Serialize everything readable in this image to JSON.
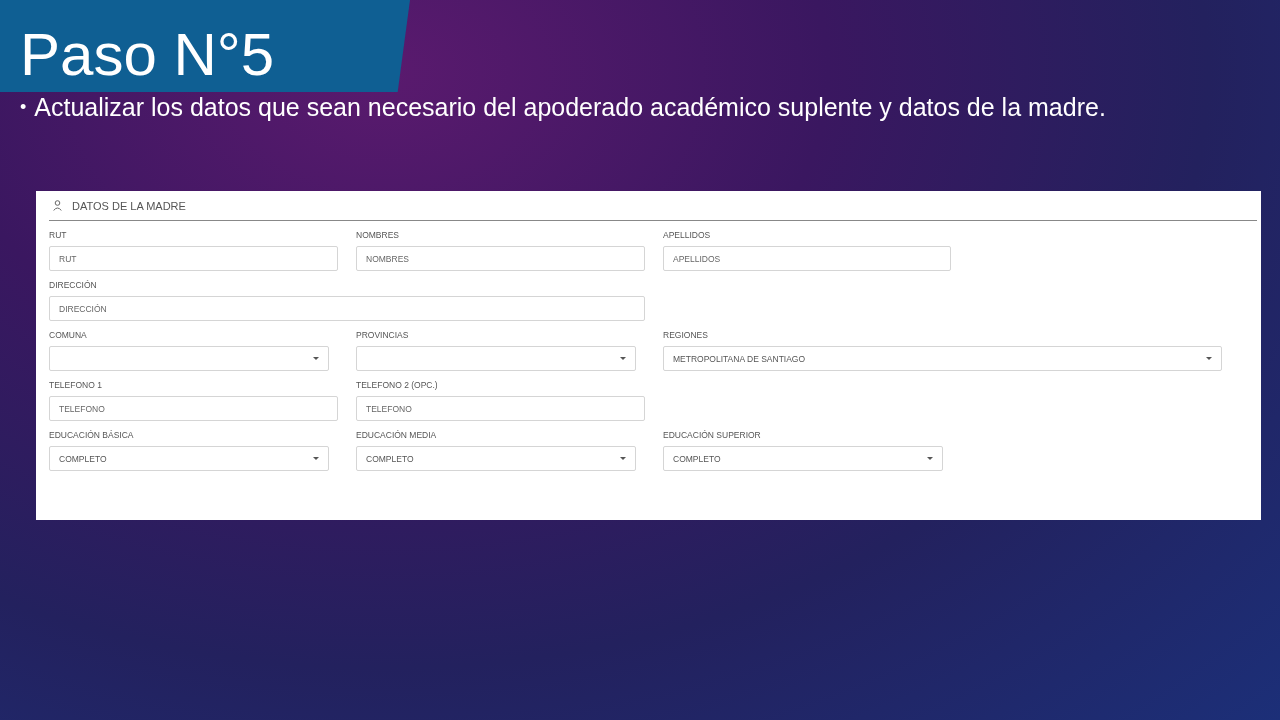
{
  "slide": {
    "title": "Paso N°5",
    "bullet_marker": "•",
    "bullet": "Actualizar los datos que sean necesario del apoderado académico suplente y datos de la madre."
  },
  "form": {
    "title": "DATOS DE LA MADRE",
    "rows": [
      {
        "fields": [
          {
            "label": "RUT",
            "kind": "text",
            "placeholder": "RUT"
          },
          {
            "label": "NOMBRES",
            "kind": "text",
            "placeholder": "NOMBRES"
          },
          {
            "label": "APELLIDOS",
            "kind": "text",
            "placeholder": "APELLIDOS"
          }
        ]
      },
      {
        "fields": [
          {
            "label": "DIRECCIÓN",
            "kind": "text",
            "placeholder": "DIRECCIÓN"
          }
        ]
      },
      {
        "fields": [
          {
            "label": "COMUNA",
            "kind": "select"
          },
          {
            "label": "PROVINCIAS",
            "kind": "select"
          },
          {
            "label": "REGIONES",
            "kind": "select",
            "value": "METROPOLITANA DE SANTIAGO"
          }
        ]
      },
      {
        "fields": [
          {
            "label": "TELEFONO 1",
            "kind": "text",
            "placeholder": "TELEFONO"
          },
          {
            "label": "TELEFONO 2 (OPC.)",
            "kind": "text",
            "placeholder": "TELEFONO"
          }
        ]
      },
      {
        "fields": [
          {
            "label": "EDUCACIÓN BÁSICA",
            "kind": "select",
            "value": "COMPLETO"
          },
          {
            "label": "EDUCACIÓN MEDIA",
            "kind": "select",
            "value": "COMPLETO"
          },
          {
            "label": "EDUCACIÓN SUPERIOR",
            "kind": "select",
            "value": "COMPLETO"
          }
        ]
      }
    ]
  }
}
